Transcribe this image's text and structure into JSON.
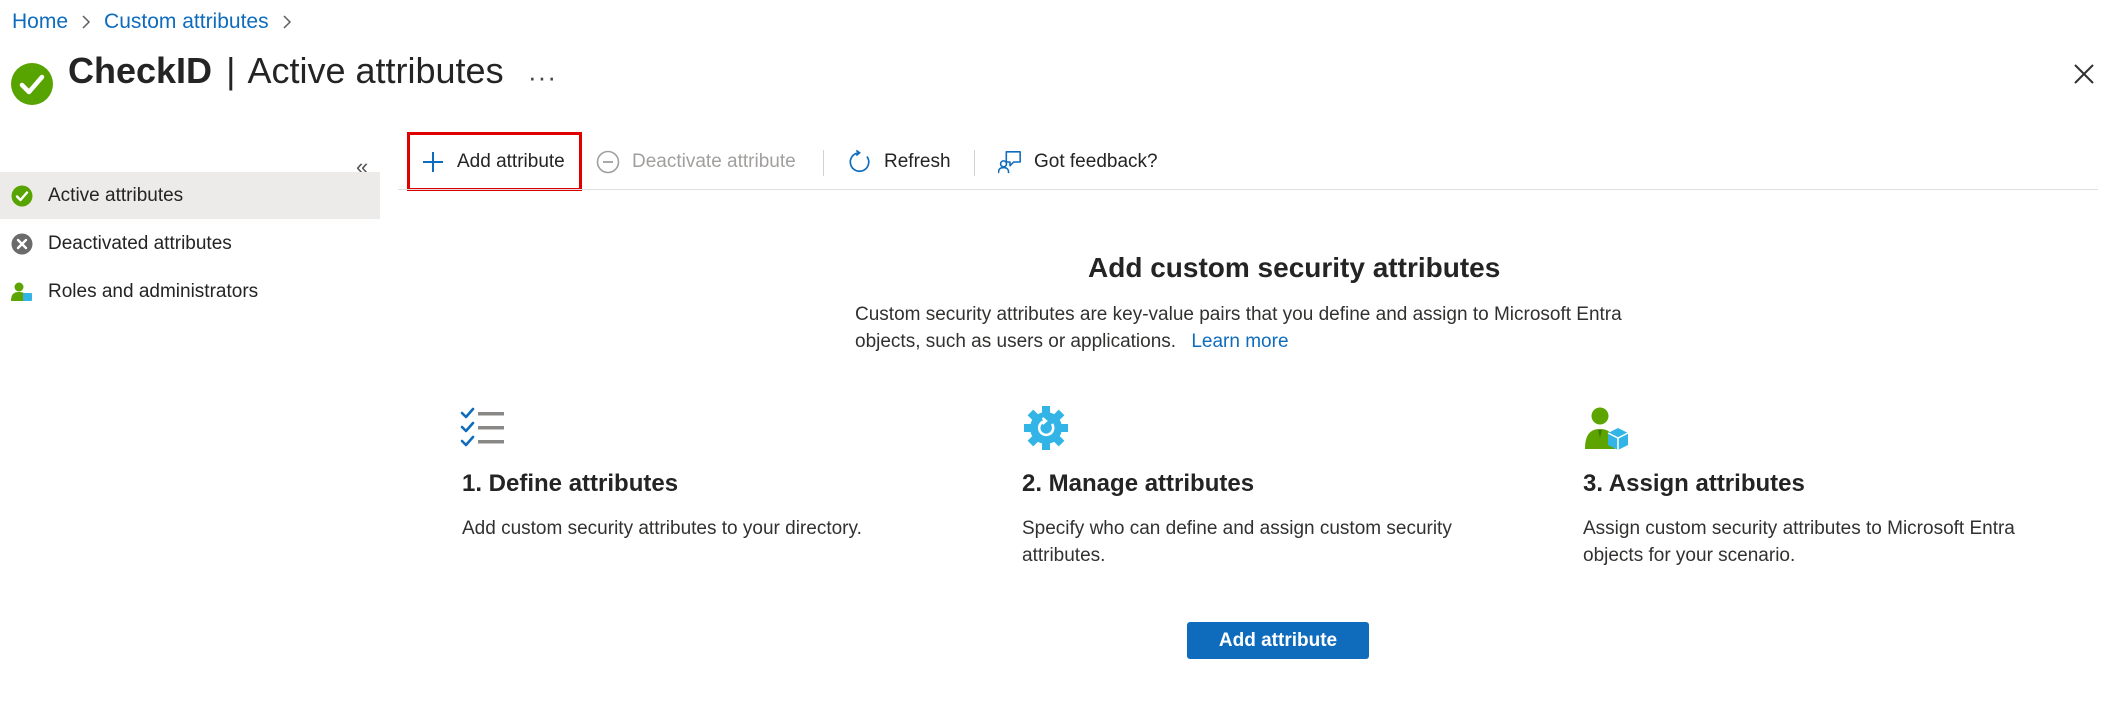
{
  "breadcrumb": {
    "home": "Home",
    "current": "Custom attributes"
  },
  "header": {
    "app_name": "CheckID",
    "separator": "|",
    "page_name": "Active attributes",
    "more": "···"
  },
  "sidebar": {
    "collapse_glyph": "«",
    "items": [
      {
        "label": "Active attributes",
        "icon": "check-circle-icon",
        "active": true
      },
      {
        "label": "Deactivated attributes",
        "icon": "x-circle-icon",
        "active": false
      },
      {
        "label": "Roles and administrators",
        "icon": "user-admin-icon",
        "active": false
      }
    ]
  },
  "toolbar": {
    "add": "Add attribute",
    "deactivate": "Deactivate attribute",
    "refresh": "Refresh",
    "feedback": "Got feedback?"
  },
  "main": {
    "title": "Add custom security attributes",
    "description": "Custom security attributes are key-value pairs that you define and assign to Microsoft Entra objects, such as users or applications.",
    "learn_more": "Learn more",
    "steps": [
      {
        "title": "1. Define attributes",
        "desc": "Add custom security attributes to your directory.",
        "icon": "checklist-icon"
      },
      {
        "title": "2. Manage attributes",
        "desc": "Specify who can define and assign custom security attributes.",
        "icon": "gear-icon"
      },
      {
        "title": "3. Assign attributes",
        "desc": "Assign custom security attributes to Microsoft Entra objects for your scenario.",
        "icon": "user-assign-icon"
      }
    ],
    "primary_button": "Add attribute"
  },
  "colors": {
    "accent": "#0f6cbd",
    "success": "#57a300",
    "highlight": "#e00000"
  }
}
